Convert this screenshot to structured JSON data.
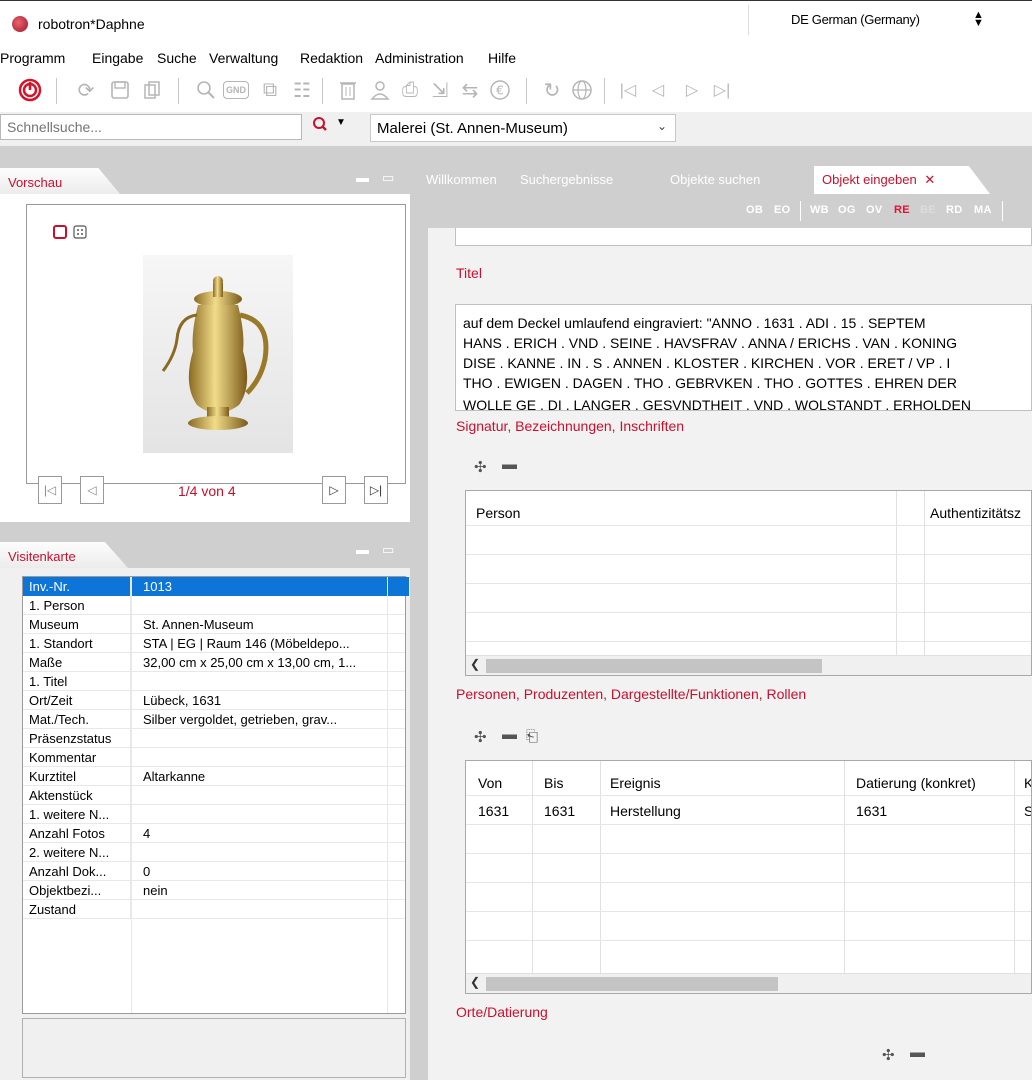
{
  "window": {
    "title": "robotron*Daphne",
    "language": "DE German (Germany)"
  },
  "menu": [
    "Programm",
    "Eingabe",
    "Suche",
    "Verwaltung",
    "Redaktion",
    "Administration",
    "Hilfe"
  ],
  "toolbar": {
    "gnd_label": "GND"
  },
  "search": {
    "placeholder": "Schnellsuche...",
    "database": "Malerei (St. Annen-Museum)"
  },
  "preview": {
    "title": "Vorschau",
    "page_indicator": "1/4 von 4"
  },
  "card": {
    "title": "Visitenkarte",
    "rows": [
      {
        "key": "Inv.-Nr.",
        "value": "1013"
      },
      {
        "key": "1. Person",
        "value": ""
      },
      {
        "key": "Museum",
        "value": "St. Annen-Museum"
      },
      {
        "key": "1. Standort",
        "value": "STA | EG | Raum 146 (Möbeldepo..."
      },
      {
        "key": "Maße",
        "value": "32,00 cm x 25,00 cm x 13,00 cm, 1..."
      },
      {
        "key": "1. Titel",
        "value": ""
      },
      {
        "key": "Ort/Zeit",
        "value": "Lübeck, 1631"
      },
      {
        "key": "Mat./Tech.",
        "value": "Silber vergoldet, getrieben, grav..."
      },
      {
        "key": "Präsenzstatus",
        "value": ""
      },
      {
        "key": "Kommentar",
        "value": ""
      },
      {
        "key": "Kurztitel",
        "value": "Altarkanne"
      },
      {
        "key": "Aktenstück",
        "value": ""
      },
      {
        "key": "1. weitere N...",
        "value": ""
      },
      {
        "key": "Anzahl Fotos",
        "value": "4"
      },
      {
        "key": "2. weitere N...",
        "value": ""
      },
      {
        "key": "Anzahl Dok...",
        "value": "0"
      },
      {
        "key": "Objektbezi...",
        "value": "nein"
      },
      {
        "key": "Zustand",
        "value": ""
      }
    ]
  },
  "tabs": [
    "Willkommen",
    "Suchergebnisse",
    "Objekte suchen",
    "Objekt eingeben"
  ],
  "subnav": [
    "OB",
    "EO",
    "WB",
    "OG",
    "OV",
    "RE",
    "BE",
    "RD",
    "MA"
  ],
  "sections": {
    "titel": "Titel",
    "signatur": "Signatur, Bezeichnungen, Inschriften",
    "personen": "Personen, Produzenten, Dargestellte/Funktionen, Rollen",
    "orte": "Orte/Datierung"
  },
  "inscription_lines": [
    "auf dem Deckel umlaufend eingraviert: \"ANNO . 1631 . ADI . 15 . SEPTEM",
    "HANS . ERICH . VND . SEINE . HAVSFRAV . ANNA / ERICHS . VAN . KONING",
    "DISE . KANNE . IN . S . ANNEN . KLOSTER . KIRCHEN . VOR . ERET / VP . I",
    "THO . EWIGEN . DAGEN . THO . GEBRVKEN . THO . GOTTES . EHREN DER",
    "WOLLE GE . DI . LANGER . GESVNDTHEIT . VND . WOLSTANDT . ERHOLDEN"
  ],
  "persons_grid": {
    "headers": [
      "Person",
      "Authentizitätsz"
    ]
  },
  "places_grid": {
    "headers": [
      "Von",
      "Bis",
      "Ereignis",
      "Datierung (konkret)",
      "Kl"
    ],
    "rows": [
      [
        "1631",
        "1631",
        "Herstellung",
        "1631",
        "St"
      ]
    ]
  },
  "colors": {
    "accent": "#c8102e",
    "selection": "#0d74d8",
    "panel_gray": "#cfcfcf"
  }
}
